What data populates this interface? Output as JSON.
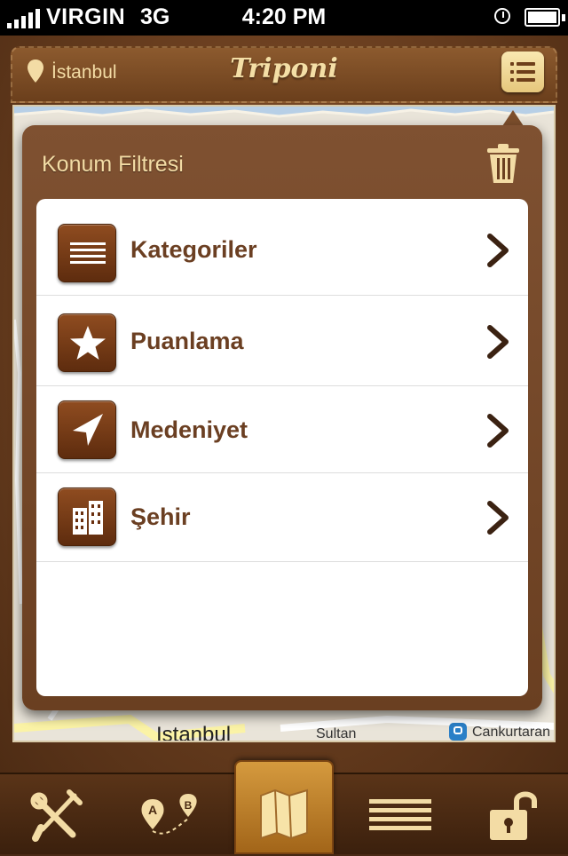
{
  "status_bar": {
    "carrier": "VIRGIN",
    "network": "3G",
    "time": "4:20 PM"
  },
  "header": {
    "location": "İstanbul",
    "logo": "Triponi",
    "menu_icon": "list-icon"
  },
  "map": {
    "labels": [
      "Istanbul",
      "Sultan",
      "Cankurtaran"
    ]
  },
  "popover": {
    "title": "Konum Filtresi",
    "items": [
      {
        "label": "Kategoriler",
        "icon": "lines-icon"
      },
      {
        "label": "Puanlama",
        "icon": "star-icon"
      },
      {
        "label": "Medeniyet",
        "icon": "navigation-arrow-icon"
      },
      {
        "label": "Şehir",
        "icon": "buildings-icon"
      }
    ]
  },
  "tab_bar": {
    "tabs": [
      {
        "icon": "tools-icon"
      },
      {
        "icon": "route-icon",
        "points": [
          "A",
          "B"
        ]
      },
      {
        "icon": "map-icon",
        "active": true
      },
      {
        "icon": "list-icon"
      },
      {
        "icon": "unlock-icon"
      }
    ]
  },
  "colors": {
    "leather": "#6e4121",
    "accent": "#f3dca5",
    "item_text": "#6b3f22",
    "active_tab": "#d59a3e"
  }
}
